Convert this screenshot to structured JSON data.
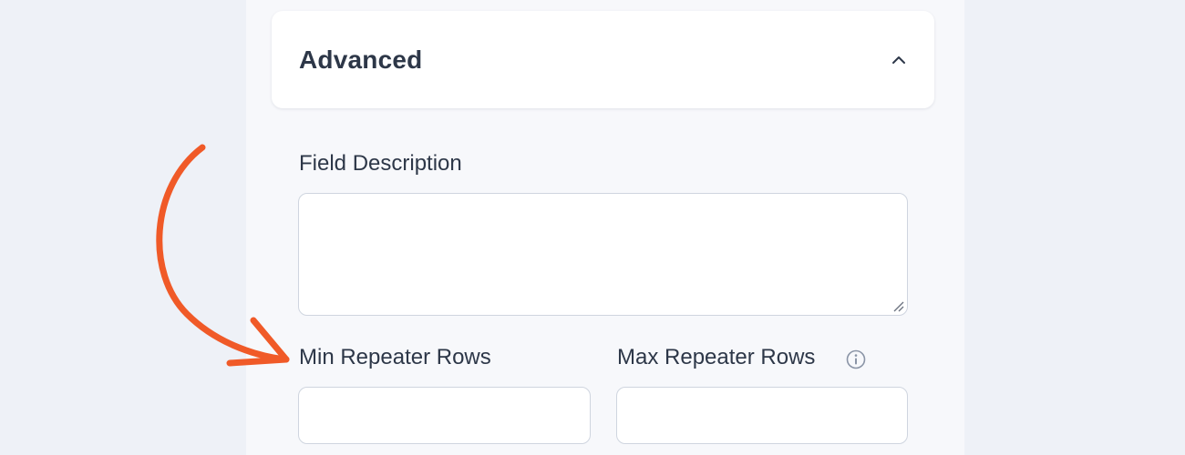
{
  "panel": {
    "section": {
      "title": "Advanced",
      "toggle_icon": "chevron-up-icon",
      "expanded": true
    },
    "fields": {
      "description": {
        "label": "Field Description",
        "value": ""
      },
      "min_rows": {
        "label": "Min Repeater Rows",
        "value": ""
      },
      "max_rows": {
        "label": "Max Repeater Rows",
        "value": "",
        "help_icon": "info-icon"
      }
    }
  },
  "annotation": {
    "icon": "curved-arrow-icon",
    "color": "#f05a28"
  },
  "colors": {
    "text": "#2d3748",
    "border": "#cfd5df",
    "page_background": "#eef1f7",
    "panel_background": "#f7f8fb"
  }
}
